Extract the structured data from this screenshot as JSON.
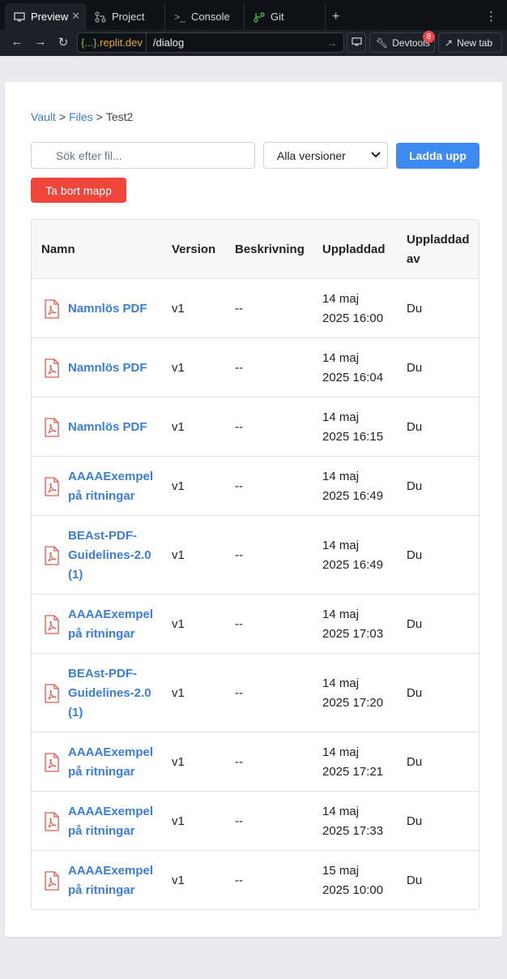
{
  "browser": {
    "tabs": [
      {
        "label": "Preview",
        "icon": "monitor-icon"
      },
      {
        "label": "Project",
        "icon": "branch-icon"
      },
      {
        "label": "Console",
        "icon": "terminal-icon"
      },
      {
        "label": "Git",
        "icon": "git-icon"
      }
    ],
    "url_badge_prefix": "{...}",
    "url_badge_domain": ".replit.dev",
    "url_path": "/dialog",
    "devtools_label": "Devtools",
    "devtools_count": "8",
    "newtab_label": "New tab"
  },
  "breadcrumb": {
    "items": [
      "Vault",
      "Files"
    ],
    "current": "Test2",
    "separator": ">"
  },
  "search": {
    "placeholder": "Sök efter fil..."
  },
  "version_select": {
    "selected": "Alla versioner"
  },
  "buttons": {
    "upload": "Ladda upp",
    "delete_folder": "Ta bort mapp"
  },
  "table": {
    "headers": {
      "name": "Namn",
      "version": "Version",
      "description": "Beskrivning",
      "uploaded": "Uppladdad",
      "uploaded_by_1": "Uppladdad",
      "uploaded_by_2": "av"
    },
    "rows": [
      {
        "name": [
          "Namnlös PDF"
        ],
        "version": "v1",
        "description": "--",
        "date": "14 maj",
        "time": "2025 16:00",
        "by": "Du"
      },
      {
        "name": [
          "Namnlös PDF"
        ],
        "version": "v1",
        "description": "--",
        "date": "14 maj",
        "time": "2025 16:04",
        "by": "Du"
      },
      {
        "name": [
          "Namnlös PDF"
        ],
        "version": "v1",
        "description": "--",
        "date": "14 maj",
        "time": "2025 16:15",
        "by": "Du"
      },
      {
        "name": [
          "AAAAExempel",
          "på ritningar"
        ],
        "version": "v1",
        "description": "--",
        "date": "14 maj",
        "time": "2025 16:49",
        "by": "Du"
      },
      {
        "name": [
          "BEAst-PDF-",
          "Guidelines-2.0",
          "(1)"
        ],
        "version": "v1",
        "description": "--",
        "date": "14 maj",
        "time": "2025 16:49",
        "by": "Du"
      },
      {
        "name": [
          "AAAAExempel",
          "på ritningar"
        ],
        "version": "v1",
        "description": "--",
        "date": "14 maj",
        "time": "2025 17:03",
        "by": "Du"
      },
      {
        "name": [
          "BEAst-PDF-",
          "Guidelines-2.0",
          "(1)"
        ],
        "version": "v1",
        "description": "--",
        "date": "14 maj",
        "time": "2025 17:20",
        "by": "Du"
      },
      {
        "name": [
          "AAAAExempel",
          "på ritningar"
        ],
        "version": "v1",
        "description": "--",
        "date": "14 maj",
        "time": "2025 17:21",
        "by": "Du"
      },
      {
        "name": [
          "AAAAExempel",
          "på ritningar"
        ],
        "version": "v1",
        "description": "--",
        "date": "14 maj",
        "time": "2025 17:33",
        "by": "Du"
      },
      {
        "name": [
          "AAAAExempel",
          "på ritningar"
        ],
        "version": "v1",
        "description": "--",
        "date": "15 maj",
        "time": "2025 10:00",
        "by": "Du"
      }
    ]
  },
  "colors": {
    "accent": "#3d8bf2",
    "danger": "#f0453a",
    "link": "#3b7dd8"
  }
}
